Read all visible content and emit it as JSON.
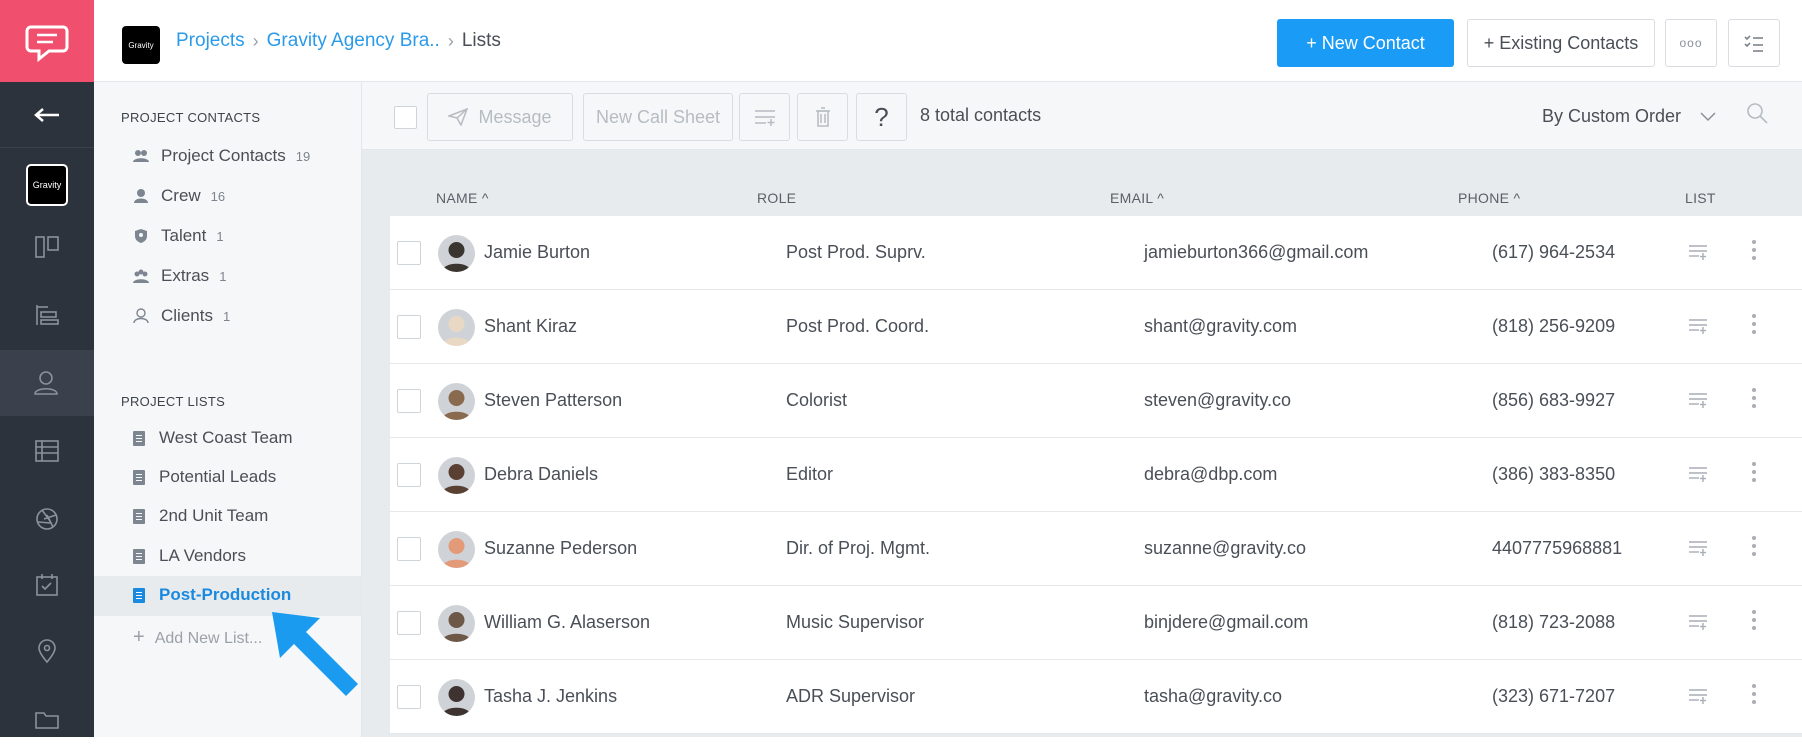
{
  "rail": {
    "logo_icon": "chat-bubble-icon",
    "back_icon": "arrow-left-icon",
    "project_badge": "Gravity",
    "items": [
      "board-icon",
      "timeline-icon",
      "contacts-icon",
      "stripboard-icon",
      "aperture-icon",
      "calendar-icon",
      "location-icon",
      "folder-icon"
    ],
    "active": "contacts-icon"
  },
  "topbar": {
    "brand": "Gravity",
    "breadcrumb": [
      "Projects",
      "Gravity Agency Bra..",
      "Lists"
    ],
    "new_contact": "+ New Contact",
    "existing_contacts": "+ Existing Contacts",
    "more": "ooo",
    "accent": "#1a9bf5"
  },
  "panel": {
    "contacts_header": "PROJECT CONTACTS",
    "contacts": [
      {
        "label": "Project Contacts",
        "count": "19"
      },
      {
        "label": "Crew",
        "count": "16"
      },
      {
        "label": "Talent",
        "count": "1"
      },
      {
        "label": "Extras",
        "count": "1"
      },
      {
        "label": "Clients",
        "count": "1"
      }
    ],
    "lists_header": "PROJECT LISTS",
    "lists": [
      "West Coast Team",
      "Potential Leads",
      "2nd Unit Team",
      "LA Vendors",
      "Post-Production"
    ],
    "selected_list": "Post-Production",
    "add_list": "Add New List..."
  },
  "toolbar": {
    "message": "Message",
    "call_sheet": "New Call Sheet",
    "help": "?",
    "count": "8 total contacts",
    "sort": "By Custom Order"
  },
  "table": {
    "headers": {
      "name": "NAME",
      "role": "ROLE",
      "email": "EMAIL",
      "phone": "PHONE",
      "list": "LIST"
    },
    "rows": [
      {
        "name": "Jamie Burton",
        "role": "Post Prod. Suprv.",
        "email": "jamieburton366@gmail.com",
        "phone": "(617) 964-2534"
      },
      {
        "name": "Shant Kiraz",
        "role": "Post Prod. Coord.",
        "email": "shant@gravity.com",
        "phone": "(818) 256-9209"
      },
      {
        "name": "Steven Patterson",
        "role": "Colorist",
        "email": "steven@gravity.co",
        "phone": "(856) 683-9927"
      },
      {
        "name": "Debra Daniels",
        "role": "Editor",
        "email": "debra@dbp.com",
        "phone": "(386) 383-8350"
      },
      {
        "name": "Suzanne Pederson",
        "role": "Dir. of Proj. Mgmt.",
        "email": "suzanne@gravity.co",
        "phone": "4407775968881"
      },
      {
        "name": "William G. Alaserson",
        "role": "Music Supervisor",
        "email": "binjdere@gmail.com",
        "phone": "(818) 723-2088"
      },
      {
        "name": "Tasha J. Jenkins",
        "role": "ADR Supervisor",
        "email": "tasha@gravity.co",
        "phone": "(323) 671-7207"
      }
    ]
  }
}
